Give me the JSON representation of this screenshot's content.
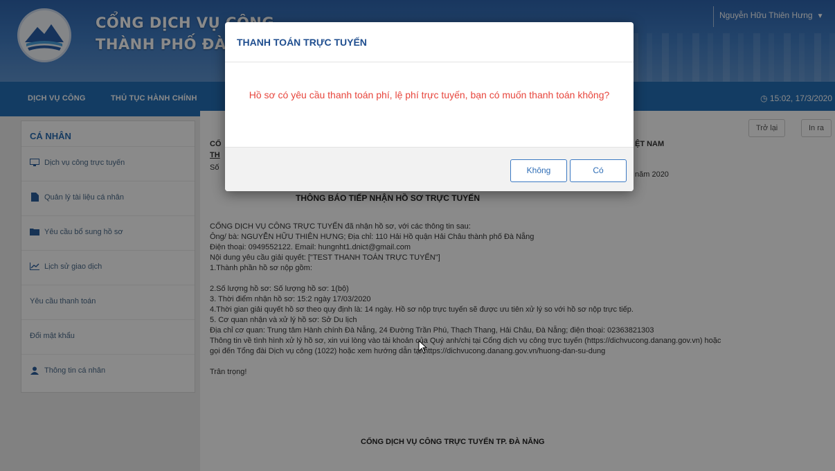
{
  "header": {
    "title_line1": "CỔNG DỊCH VỤ CÔNG",
    "title_line2": "THÀNH PHỐ ĐÀ NẴNG",
    "user_name": "Nguyễn Hữu Thiên Hưng"
  },
  "nav": {
    "items": [
      "DỊCH VỤ CÔNG",
      "THỦ TỤC HÀNH CHÍNH"
    ],
    "time": "15:02, 17/3/2020"
  },
  "sidebar": {
    "title": "CÁ NHÂN",
    "items": [
      {
        "label": "Dịch vụ công trực tuyến",
        "icon": "monitor-icon"
      },
      {
        "label": "Quản lý tài liệu cá nhân",
        "icon": "file-icon"
      },
      {
        "label": "Yêu cầu bổ sung hồ sơ",
        "icon": "folder-icon"
      },
      {
        "label": "Lịch sử giao dịch",
        "icon": "chart-icon"
      },
      {
        "label": "Yêu cầu thanh toán",
        "icon": ""
      },
      {
        "label": "Đổi mật khẩu",
        "icon": ""
      },
      {
        "label": "Thông tin cá nhân",
        "icon": "user-icon"
      }
    ]
  },
  "toolbar": {
    "back_label": "Trở lại",
    "print_label": "In ra"
  },
  "document": {
    "header_left": "CỔ",
    "header_left_2": "TH",
    "header_left_3": "Số",
    "header_right": "ỆT NAM",
    "header_right_date": "năm 2020",
    "title": "THÔNG BÁO TIẾP NHẬN HỒ SƠ TRỰC TUYẾN",
    "lines": [
      "CỔNG DỊCH VỤ CÔNG TRỰC TUYẾN đã nhận hồ sơ, với các thông tin sau:",
      "Ông/ bà: NGUYỄN HỮU THIÊN HƯNG; Địa chỉ: 110 Hải Hồ quận Hải Châu thành phố Đà Nẵng",
      "Điện thoại: 0949552122. Email: hungnht1.dnict@gmail.com",
      "Nội dung yêu cầu giải quyết: [\"TEST THANH TOÁN TRỰC TUYẾN\"]",
      " 1.Thành phần hồ sơ nộp gồm:",
      "",
      " 2.Số lượng hồ sơ: Số lượng hồ sơ: 1(bộ)",
      " 3. Thời điểm nhận hồ sơ: 15:2 ngày 17/03/2020",
      " 4.Thời gian giải quyết hồ sơ theo quy định là: 14 ngày. Hồ sơ nộp trực tuyến sẽ được ưu tiên xử lý so với hồ sơ nộp trực tiếp.",
      " 5. Cơ quan nhận và xử lý hồ sơ: Sở Du lịch",
      " Địa chỉ cơ quan: Trung tâm Hành chính Đà Nẵng, 24 Đường Trần Phú, Thạch Thang, Hải Châu, Đà Nẵng; điện thoại: 02363821303",
      "Thông tin về tình hình xử lý hồ sơ, xin vui lòng vào tài khoản của Quý anh/chị tại Cổng dịch vụ công trực tuyến (https://dichvucong.danang.gov.vn) hoặc",
      "gọi đến Tổng đài Dịch vụ công (1022) hoặc xem hướng dẫn tại https://dichvucong.danang.gov.vn/huong-dan-su-dung",
      "",
      "Trân trọng!"
    ],
    "footer": "CỔNG DỊCH VỤ CÔNG TRỰC TUYẾN TP. ĐÀ NẴNG"
  },
  "modal": {
    "title": "THANH TOÁN TRỰC TUYẾN",
    "message": "Hồ sơ có yêu cầu thanh toán phí, lệ phí trực tuyến, bạn có muốn thanh toán không?",
    "no_label": "Không",
    "yes_label": "Có"
  },
  "colors": {
    "banner": "#2f66b0",
    "navbar": "#246fb7",
    "modal_title": "#1f4e8f",
    "modal_message": "#e7453c",
    "sidebar_title": "#2a6db3"
  }
}
